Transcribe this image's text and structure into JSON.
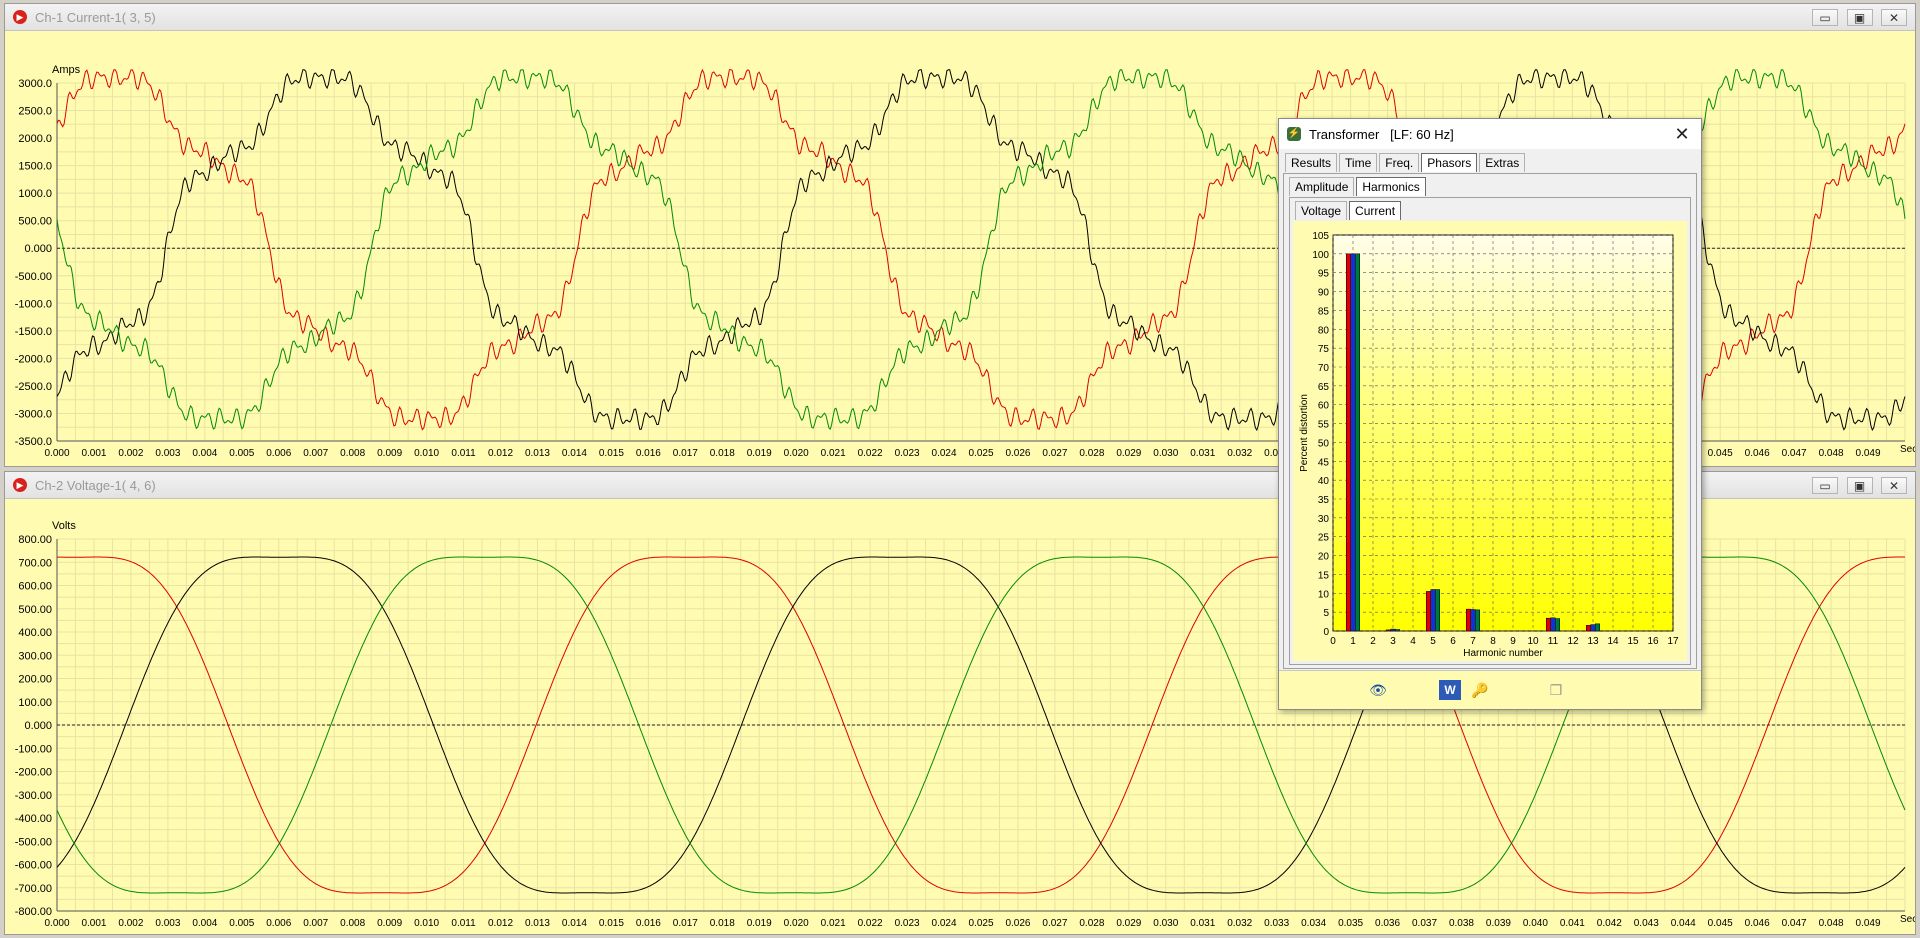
{
  "windows": [
    {
      "id": "ch1",
      "title": "Ch-1 Current-1( 3, 5)",
      "buttons": [
        "▭",
        "▣",
        "✕"
      ]
    },
    {
      "id": "ch2",
      "title": "Ch-2 Voltage-1( 4, 6)",
      "buttons": [
        "▭",
        "▣",
        "✕"
      ]
    }
  ],
  "colors": {
    "phase_a": "#e00000",
    "phase_b": "#000000",
    "phase_c": "#008c00",
    "plot_bg": "#fffbb0",
    "grid": "#e8e3a4"
  },
  "dialog": {
    "title": "Transformer   [LF: 60 Hz]",
    "close": "✕",
    "tabs_main": [
      "Results",
      "Time",
      "Freq.",
      "Phasors",
      "Extras"
    ],
    "tabs_sub": [
      "Amplitude",
      "Harmonics"
    ],
    "tabs_sub2": [
      "Voltage",
      "Current"
    ],
    "toolbar": [
      {
        "icon": "eye-icon",
        "glyph": "👁"
      },
      {
        "icon": "word-export-icon",
        "glyph": "W"
      },
      {
        "icon": "key-icon",
        "glyph": "🔑"
      },
      {
        "icon": "copy-windows-icon",
        "glyph": "❐"
      }
    ]
  },
  "chart_data": [
    {
      "type": "line",
      "ylabel": "Amps",
      "xunit": "Sec",
      "xlim": [
        0,
        0.05
      ],
      "ylim": [
        -3500,
        3000
      ],
      "yticks": [
        "3000.0",
        "2500.0",
        "2000.0",
        "1500.0",
        "1000.0",
        "500.00",
        "0.000",
        "-500.00",
        "-1000.0",
        "-1500.0",
        "-2000.0",
        "-2500.0",
        "-3000.0",
        "-3500.0"
      ],
      "xticks": [
        "0.000",
        "0.001",
        "0.002",
        "0.003",
        "0.004",
        "0.005",
        "0.006",
        "0.007",
        "0.008",
        "0.009",
        "0.010",
        "0.011",
        "0.012",
        "0.013",
        "0.014",
        "0.015",
        "0.016",
        "0.017",
        "0.018",
        "0.019",
        "0.020",
        "0.021",
        "0.022",
        "0.023",
        "0.024",
        "0.025",
        "0.026",
        "0.027",
        "0.028",
        "0.029",
        "0.030",
        "0.031",
        "0.032",
        "0.033",
        "0.034",
        "0.035",
        "0.036",
        "0.037",
        "0.038",
        "0.039",
        "0.040",
        "0.041",
        "0.042",
        "0.043",
        "0.044",
        "0.045",
        "0.046",
        "0.047",
        "0.048",
        "0.049"
      ],
      "frequency_hz": 60,
      "series": [
        {
          "color": "#e00000",
          "amplitude": 3000,
          "phase_deg": 56,
          "harmonics": {
            "5": 0.105,
            "7": 0.058,
            "11": 0.034,
            "13": 0.017
          }
        },
        {
          "color": "#000000",
          "amplitude": 3000,
          "phase_deg": -64,
          "harmonics": {
            "5": 0.105,
            "7": 0.058,
            "11": 0.034,
            "13": 0.017
          }
        },
        {
          "color": "#008c00",
          "amplitude": 3000,
          "phase_deg": 176,
          "harmonics": {
            "5": 0.105,
            "7": 0.058,
            "11": 0.034,
            "13": 0.017
          }
        }
      ]
    },
    {
      "type": "line",
      "ylabel": "Volts",
      "xunit": "Sec",
      "xlim": [
        0,
        0.05
      ],
      "ylim": [
        -800,
        800
      ],
      "yticks": [
        "800.00",
        "700.00",
        "600.00",
        "500.00",
        "400.00",
        "300.00",
        "200.00",
        "100.00",
        "0.000",
        "-100.00",
        "-200.00",
        "-300.00",
        "-400.00",
        "-500.00",
        "-600.00",
        "-700.00",
        "-800.00"
      ],
      "xticks": [
        "0.000",
        "0.001",
        "0.002",
        "0.003",
        "0.004",
        "0.005",
        "0.006",
        "0.007",
        "0.008",
        "0.009",
        "0.010",
        "0.011",
        "0.012",
        "0.013",
        "0.014",
        "0.015",
        "0.016",
        "0.017",
        "0.018",
        "0.019",
        "0.020",
        "0.021",
        "0.022",
        "0.023",
        "0.024",
        "0.025",
        "0.026",
        "0.027",
        "0.028",
        "0.029",
        "0.030",
        "0.031",
        "0.032",
        "0.033",
        "0.034",
        "0.035",
        "0.036",
        "0.037",
        "0.038",
        "0.039",
        "0.040",
        "0.041",
        "0.042",
        "0.043",
        "0.044",
        "0.045",
        "0.046",
        "0.047",
        "0.048",
        "0.049"
      ],
      "frequency_hz": 60,
      "series": [
        {
          "color": "#e00000",
          "amplitude": 820,
          "phase_deg": 80
        },
        {
          "color": "#000000",
          "amplitude": 820,
          "phase_deg": -40
        },
        {
          "color": "#008c00",
          "amplitude": 820,
          "phase_deg": 200
        }
      ]
    },
    {
      "type": "bar",
      "ylabel": "Percent distortion",
      "xlabel": "Harmonic number",
      "xlim": [
        0,
        17
      ],
      "ylim": [
        0,
        105
      ],
      "xticks": [
        "0",
        "1",
        "2",
        "3",
        "4",
        "5",
        "6",
        "7",
        "8",
        "9",
        "10",
        "11",
        "12",
        "13",
        "14",
        "15",
        "16",
        "17"
      ],
      "yticks": [
        "105",
        "100",
        "95",
        "90",
        "85",
        "80",
        "75",
        "70",
        "65",
        "60",
        "55",
        "50",
        "45",
        "40",
        "35",
        "30",
        "25",
        "20",
        "15",
        "10",
        "5",
        "0"
      ],
      "categories": [
        1,
        3,
        5,
        7,
        11,
        13
      ],
      "series": [
        {
          "color": "#e00000",
          "values": [
            100,
            0.3,
            10.5,
            5.8,
            3.4,
            1.5
          ]
        },
        {
          "color": "#1030e0",
          "values": [
            100,
            0.5,
            11.0,
            5.7,
            3.5,
            1.7
          ]
        },
        {
          "color": "#007a3a",
          "values": [
            100,
            0.4,
            11.0,
            5.6,
            3.3,
            1.9
          ]
        }
      ]
    }
  ]
}
